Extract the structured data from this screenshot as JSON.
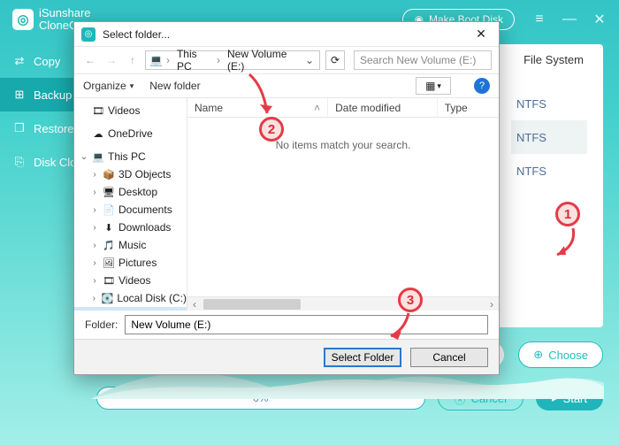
{
  "app": {
    "brand_top": "iSunshare",
    "brand_bottom": "CloneGo",
    "boot_label": "Make Boot Disk"
  },
  "sidebar": {
    "items": [
      {
        "label": "Copy"
      },
      {
        "label": "Backup"
      },
      {
        "label": "Restore"
      },
      {
        "label": "Disk Clone"
      }
    ]
  },
  "card": {
    "fs_header": "File System",
    "fs_rows": [
      "NTFS",
      "NTFS",
      "NTFS"
    ]
  },
  "choose_label": "Choose",
  "progress_text": "0%",
  "cancel_label": "Cancel",
  "start_label": "Start",
  "dialog": {
    "title": "Select folder...",
    "crumbs": [
      "This PC",
      "New Volume (E:)"
    ],
    "search_placeholder": "Search New Volume (E:)",
    "organize": "Organize",
    "newfolder": "New folder",
    "columns": {
      "name": "Name",
      "date": "Date modified",
      "type": "Type"
    },
    "empty_msg": "No items match your search.",
    "folder_label": "Folder:",
    "folder_value": "New Volume (E:)",
    "select_btn": "Select Folder",
    "cancel_btn": "Cancel",
    "tree": [
      {
        "depth": 1,
        "label": "Videos",
        "icon": "🎞"
      },
      {
        "depth": 1,
        "label": "OneDrive",
        "icon": "☁",
        "spacer_before": true
      },
      {
        "depth": 1,
        "label": "This PC",
        "icon": "💻",
        "twisty": "⌄",
        "spacer_before": true
      },
      {
        "depth": 2,
        "label": "3D Objects",
        "icon": "📦",
        "twisty": "›"
      },
      {
        "depth": 2,
        "label": "Desktop",
        "icon": "🖥",
        "twisty": "›"
      },
      {
        "depth": 2,
        "label": "Documents",
        "icon": "📄",
        "twisty": "›"
      },
      {
        "depth": 2,
        "label": "Downloads",
        "icon": "⬇",
        "twisty": "›"
      },
      {
        "depth": 2,
        "label": "Music",
        "icon": "🎵",
        "twisty": "›"
      },
      {
        "depth": 2,
        "label": "Pictures",
        "icon": "🖼",
        "twisty": "›"
      },
      {
        "depth": 2,
        "label": "Videos",
        "icon": "🎞",
        "twisty": "›"
      },
      {
        "depth": 2,
        "label": "Local Disk (C:)",
        "icon": "💽",
        "twisty": "›"
      },
      {
        "depth": 2,
        "label": "New Volume (E:)",
        "icon": "💽",
        "twisty": "›",
        "selected": true
      }
    ]
  },
  "annotations": {
    "b1": "1",
    "b2": "2",
    "b3": "3"
  }
}
